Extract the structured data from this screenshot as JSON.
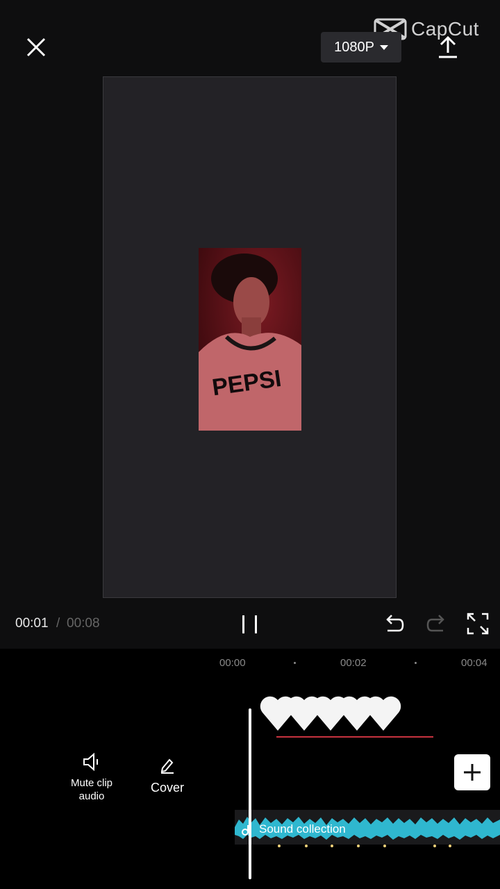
{
  "header": {
    "resolution_label": "1080P",
    "watermark_text": "CapCut"
  },
  "playback": {
    "current_time": "00:01",
    "separator": "/",
    "total_time": "00:08"
  },
  "timeline": {
    "ruler": [
      "00:00",
      "00:02",
      "00:04"
    ],
    "audio_track_label": "Sound collection"
  },
  "tools": {
    "mute_label_line1": "Mute clip",
    "mute_label_line2": "audio",
    "cover_label": "Cover"
  },
  "preview": {
    "shirt_text": "PEPSI"
  },
  "colors": {
    "accent_audio": "#2fb7cf",
    "clip_line": "#c8333f"
  }
}
